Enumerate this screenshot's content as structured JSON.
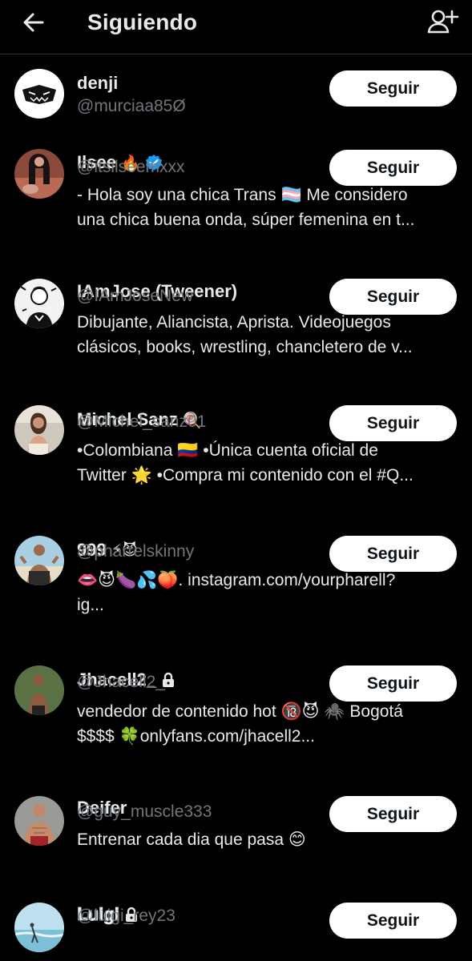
{
  "header": {
    "title": "Siguiendo",
    "back_icon": "arrow-left-icon",
    "add_icon": "add-user-icon"
  },
  "follow_label": "Seguir",
  "colors": {
    "background": "#000000",
    "text": "#e7e9ea",
    "muted": "#71767b",
    "verified": "#1d9bf0",
    "button_bg": "#ffffff"
  },
  "users": [
    {
      "name": "denji",
      "handle": "@murciaa85Ø",
      "name_emoji": "",
      "verified": false,
      "locked": false,
      "bio": []
    },
    {
      "name": "Ilsee",
      "handle": "@itsilseemxxx",
      "name_emoji": "🔥",
      "verified": true,
      "locked": false,
      "bio": [
        "- Hola soy una chica Trans 🏳️‍⚧️ Me considero",
        "una chica buena onda, súper femenina en t..."
      ]
    },
    {
      "name": "IAmJose (Tweener)",
      "handle": "@IAmJoseNew",
      "name_emoji": "",
      "verified": false,
      "locked": false,
      "bio": [
        "Dibujante, Aliancista, Aprista. Videojuegos",
        "clásicos, books, wrestling, chancletero de v..."
      ]
    },
    {
      "name": "Michel Sanz",
      "handle": "@Michel_sanz01",
      "name_emoji": "🍭",
      "verified": false,
      "locked": false,
      "bio": [
        "•Colombiana 🇨🇴 •Única cuenta oficial de",
        "Twitter 🌟 •Compra mi contenido con el #Q..."
      ]
    },
    {
      "name": "999",
      "handle": "@pharrelskinny",
      "name_emoji": "⚡😈",
      "verified": false,
      "locked": false,
      "bio": [
        "👄😈🍆💦🍑. instagram.com/yourpharell?",
        "ig..."
      ]
    },
    {
      "name": "Jhacell2_",
      "handle": "@Jhacell2_",
      "name_emoji": "",
      "verified": false,
      "locked": true,
      "bio": [
        "vendedor de contenido hot 🔞😈 🕷️ Bogotá",
        "$$$$ 🍀onlyfans.com/jhacell2..."
      ]
    },
    {
      "name": "Deifer",
      "handle": "@guy_muscle333",
      "name_emoji": "",
      "verified": false,
      "locked": false,
      "bio": [
        "Entrenar cada dia que pasa 😊"
      ]
    },
    {
      "name": "𝐋𝐮𝐢𝐠𝐢",
      "handle": "@luigi_rey23",
      "name_emoji": "",
      "verified": false,
      "locked": true,
      "bio": []
    }
  ]
}
